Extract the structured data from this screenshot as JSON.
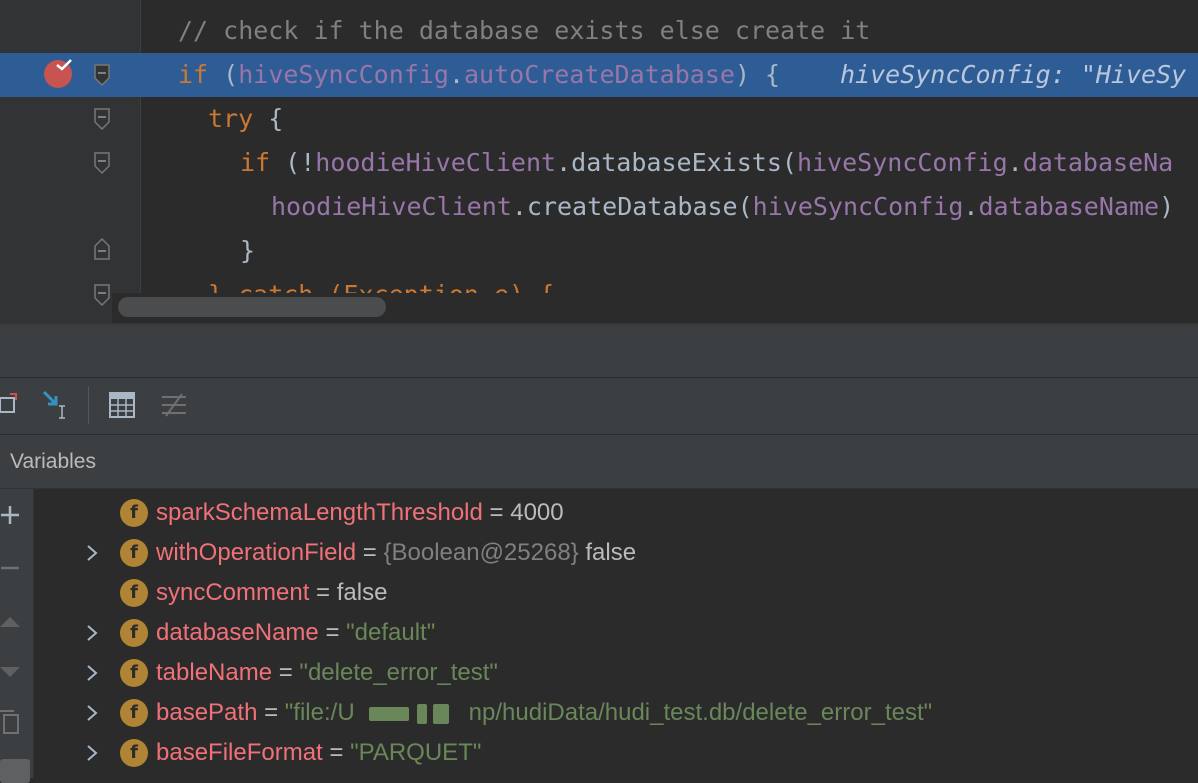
{
  "editor": {
    "lines": [
      {
        "comment": "// check if the database exists else create it"
      },
      {
        "kw_if": "if",
        "paren_open": " (",
        "obj": "hiveSyncConfig",
        "dot": ".",
        "field": "autoCreateDatabase",
        "close": ") {",
        "hint": "hiveSyncConfig: \"HiveSy"
      },
      {
        "kw_try": "try",
        "brace": " {"
      },
      {
        "kw_if": "if",
        "prefix": " (!",
        "obj": "hoodieHiveClient",
        "dot1": ".",
        "method": "databaseExists",
        "paren": "(",
        "arg_obj": "hiveSyncConfig",
        "dot2": ".",
        "arg_field": "databaseNa"
      },
      {
        "obj": "hoodieHiveClient",
        "dot1": ".",
        "method": "createDatabase",
        "paren": "(",
        "arg_obj": "hiveSyncConfig",
        "dot2": ".",
        "arg_field": "databaseName",
        "close": ")"
      },
      {
        "brace": "}"
      },
      {
        "partial": "} catch (Exception e) {"
      }
    ]
  },
  "debugger": {
    "variables_title": "Variables",
    "variables": [
      {
        "name": "sparkSchemaLengthThreshold",
        "eq": " = ",
        "value": "4000",
        "kind": "num",
        "expandable": false
      },
      {
        "name": "withOperationField",
        "eq": " = ",
        "type": "{Boolean@25268}",
        "value": " false",
        "kind": "obj",
        "expandable": true
      },
      {
        "name": "syncComment",
        "eq": " = ",
        "value": "false",
        "kind": "bool",
        "expandable": false
      },
      {
        "name": "databaseName",
        "eq": " = ",
        "value": "\"default\"",
        "kind": "str",
        "expandable": true
      },
      {
        "name": "tableName",
        "eq": " = ",
        "value": "\"delete_error_test\"",
        "kind": "str",
        "expandable": true
      },
      {
        "name": "basePath",
        "eq": " = ",
        "value_start": "\"file:/U",
        "value_end": "np/hudiData/hudi_test.db/delete_error_test\"",
        "kind": "str-redacted",
        "expandable": true
      },
      {
        "name": "baseFileFormat",
        "eq": " = ",
        "value": "\"PARQUET\"",
        "kind": "str",
        "expandable": true
      }
    ],
    "badge_letter": "f"
  },
  "colors": {
    "editor_bg": "#2b2b2b",
    "exec_line": "#2e5d96",
    "keyword": "#cc7832",
    "field": "#9876aa",
    "string": "#6a8759",
    "var_name": "#f07178",
    "breakpoint": "#c75450"
  },
  "icons": {
    "breakpoint": "breakpoint-verified-icon",
    "fold": "fold-marker-icon",
    "toolbar": [
      "restore-layout-icon",
      "step-into-cursor-icon",
      "evaluate-expression-icon",
      "toggle-filter-icon"
    ],
    "side": [
      "add-icon",
      "remove-icon",
      "up-icon",
      "down-icon",
      "copy-icon",
      "glasses-icon"
    ],
    "expand": "chevron-right-icon"
  }
}
